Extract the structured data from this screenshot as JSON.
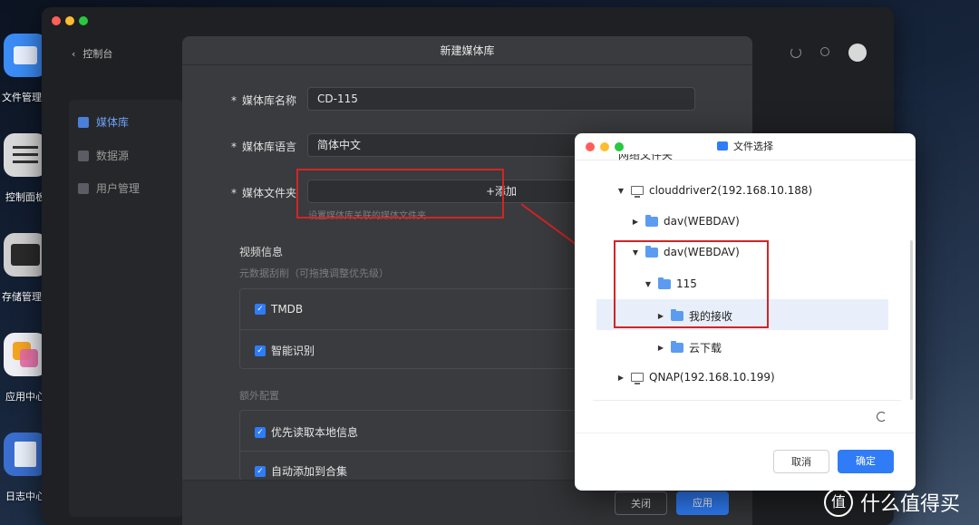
{
  "desktop": {
    "apps": [
      {
        "label": "文件管理",
        "color": "#3b8cf5"
      },
      {
        "label": "控制面板",
        "color": "#d9d9d9"
      },
      {
        "label": "存储管理",
        "color": "#cfcfcf"
      },
      {
        "label": "应用中心",
        "color": "#e86aa8"
      },
      {
        "label": "日志中心",
        "color": "#3a6fcf"
      }
    ],
    "help_icon": "?"
  },
  "window": {
    "back_label": "控制台",
    "nav": [
      {
        "label": "媒体库",
        "icon": "media-icon",
        "active": true
      },
      {
        "label": "数据源",
        "icon": "datasource-icon",
        "active": false
      },
      {
        "label": "用户管理",
        "icon": "users-icon",
        "active": false
      }
    ]
  },
  "dialog": {
    "title": "新建媒体库",
    "name_label": "媒体库名称",
    "name_value": "CD-115",
    "lang_label": "媒体库语言",
    "lang_value": "简体中文",
    "folder_label": "媒体文件夹",
    "add_button": "+添加",
    "folder_hint": "设置媒体库关联的媒体文件夹",
    "video_section": "视频信息",
    "scraper_hint": "元数据刮削（可拖拽调整优先级）",
    "scrapers": [
      "TMDB",
      "智能识别"
    ],
    "extra_section": "额外配置",
    "extras": [
      "优先读取本地信息",
      "自动添加到合集"
    ],
    "close_button": "关闭",
    "apply_button": "应用"
  },
  "file_chooser": {
    "title": "文件选择",
    "partial_header": "网络文件夹",
    "tree": [
      {
        "label": "clouddriver2(192.168.10.188)",
        "type": "computer",
        "expanded": true,
        "level": 0
      },
      {
        "label": "dav(WEBDAV)",
        "type": "folder",
        "expanded": false,
        "level": 1
      },
      {
        "label": "dav(WEBDAV)",
        "type": "folder",
        "expanded": true,
        "level": 1
      },
      {
        "label": "115",
        "type": "folder",
        "expanded": true,
        "level": 2
      },
      {
        "label": "我的接收",
        "type": "folder",
        "expanded": false,
        "level": 3,
        "selected": true
      },
      {
        "label": "云下载",
        "type": "folder",
        "expanded": false,
        "level": 3
      },
      {
        "label": "QNAP(192.168.10.199)",
        "type": "computer",
        "expanded": false,
        "level": 0
      }
    ],
    "cancel_button": "取消",
    "confirm_button": "确定"
  },
  "watermark": {
    "logo_char": "值",
    "text": "什么值得买"
  },
  "colors": {
    "accent": "#2f7cf6",
    "annotation": "#d42424"
  }
}
